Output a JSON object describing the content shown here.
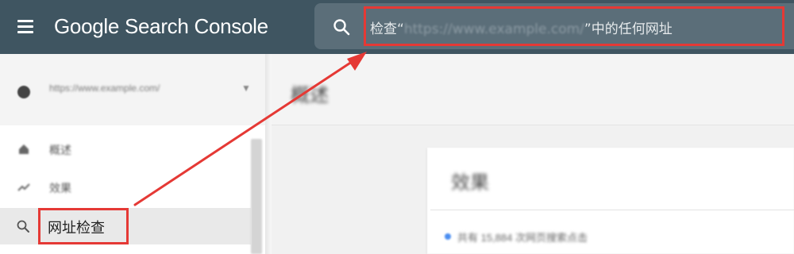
{
  "app": {
    "title": "Google Search Console"
  },
  "search": {
    "prefix": "检查“",
    "url": "https://www.example.com/",
    "suffix": "”中的任何网址"
  },
  "sidebar": {
    "property": "https://www.example.com/",
    "items": [
      {
        "label": "概述",
        "icon": "home-icon"
      },
      {
        "label": "效果",
        "icon": "trend-icon"
      },
      {
        "label": "网址检查",
        "icon": "search-icon"
      }
    ]
  },
  "main": {
    "title": "概述",
    "card_title": "效果",
    "card_stat": "共有 15,884 次网页搜索点击"
  },
  "colors": {
    "topbar": "#3f5561",
    "highlight": "#e53935",
    "accent": "#4b8ef1"
  }
}
